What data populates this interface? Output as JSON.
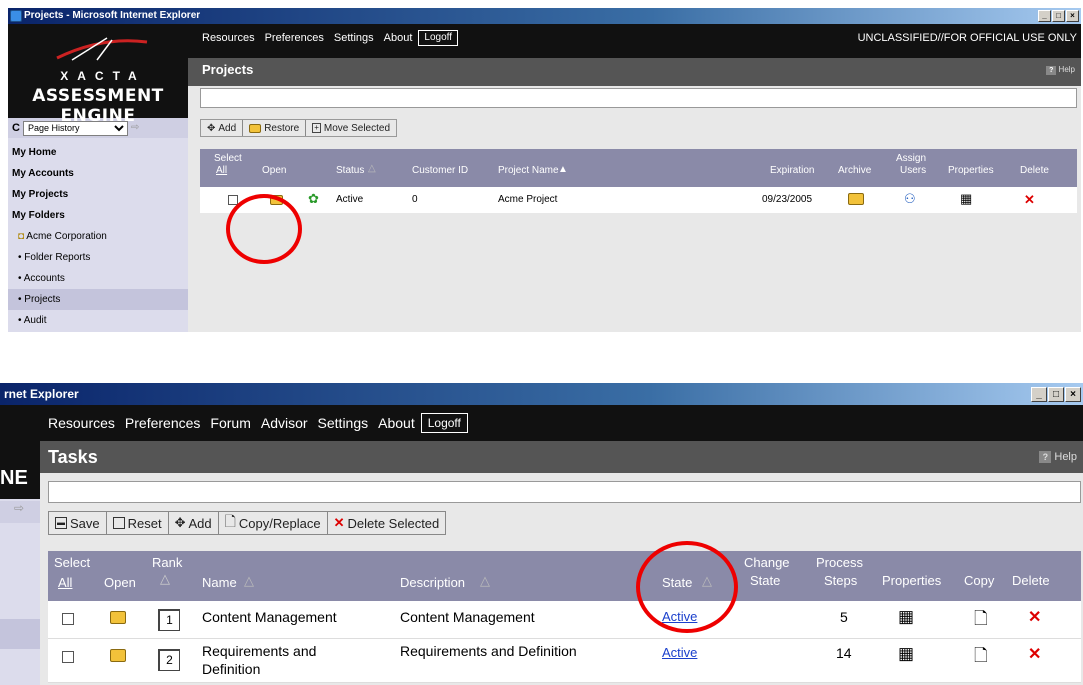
{
  "colors": {
    "accent_red": "#e00000",
    "header_bar": "#8a8aa8",
    "nav_black": "#111111",
    "sidebar": "#dcdcec"
  },
  "shot1": {
    "window_title": "Projects - Microsoft Internet Explorer",
    "logo": {
      "brand": "XACTA",
      "product": "ASSESSMENT ENGINE"
    },
    "page_history": {
      "selected": "Page History"
    },
    "nav": {
      "links": [
        "Resources",
        "Preferences",
        "Settings",
        "About"
      ],
      "logoff": "Logoff",
      "classification": "UNCLASSIFIED//FOR OFFICIAL USE ONLY"
    },
    "sidebar": {
      "items": [
        {
          "label": "My Home"
        },
        {
          "label": "My Accounts"
        },
        {
          "label": "My Projects"
        },
        {
          "label": "My Folders"
        },
        {
          "label": "Acme Corporation"
        },
        {
          "label": "• Folder Reports"
        },
        {
          "label": "• Accounts"
        },
        {
          "label": "• Projects"
        },
        {
          "label": "• Audit"
        }
      ]
    },
    "page_title": "Projects",
    "help_label": "Help",
    "toolbar": {
      "add": "Add",
      "restore": "Restore",
      "move_selected": "Move Selected"
    },
    "table": {
      "headers": {
        "select": "Select",
        "all": "All",
        "open": "Open",
        "status": "Status",
        "customer_id": "Customer ID",
        "project_name": "Project Name",
        "expiration": "Expiration",
        "archive": "Archive",
        "assign": "Assign",
        "users": "Users",
        "properties": "Properties",
        "delete": "Delete"
      },
      "rows": [
        {
          "status": "Active",
          "customer_id": "0",
          "project_name": "Acme Project",
          "expiration": "09/23/2005"
        }
      ]
    }
  },
  "shot2": {
    "window_title": "rnet Explorer",
    "nav": {
      "links": [
        "Resources",
        "Preferences",
        "Forum",
        "Advisor",
        "Settings",
        "About"
      ],
      "logoff": "Logoff"
    },
    "logo_fragment": "NE",
    "page_title": "Tasks",
    "help_label": "Help",
    "toolbar": {
      "save": "Save",
      "reset": "Reset",
      "add": "Add",
      "copy_replace": "Copy/Replace",
      "delete_selected": "Delete Selected"
    },
    "table": {
      "headers": {
        "select": "Select",
        "all": "All",
        "open": "Open",
        "rank": "Rank",
        "name": "Name",
        "description": "Description",
        "state": "State",
        "change": "Change",
        "change_state": "State",
        "process": "Process",
        "steps": "Steps",
        "properties": "Properties",
        "copy": "Copy",
        "delete": "Delete"
      },
      "rows": [
        {
          "rank": "1",
          "name": "Content Management",
          "name2": "",
          "description": "Content Management",
          "state": "Active",
          "steps": "5"
        },
        {
          "rank": "2",
          "name": "Requirements and",
          "name2": "Definition",
          "description": "Requirements and Definition",
          "state": "Active",
          "steps": "14"
        }
      ]
    }
  }
}
